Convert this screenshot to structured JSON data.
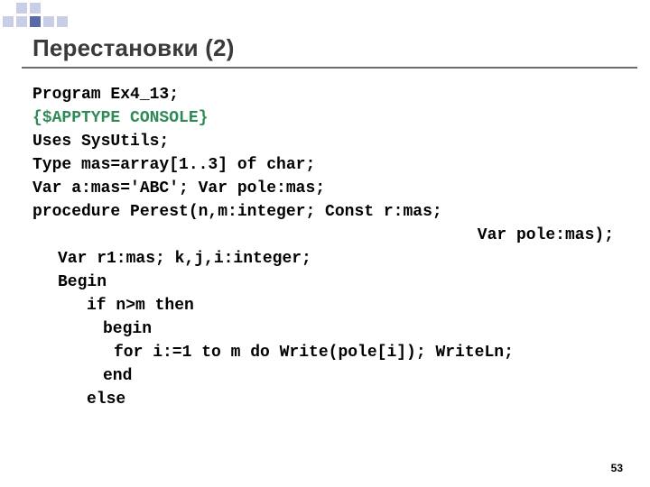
{
  "decor_pattern": [
    "n",
    "l",
    "l",
    "n",
    "n",
    "n",
    "l",
    "l",
    "d",
    "l",
    "l",
    "n"
  ],
  "title": "Перестановки (2)",
  "code": {
    "l1": "Program Ex4_13;",
    "l2": "{$APPTYPE CONSOLE}",
    "l3": "Uses SysUtils;",
    "l4": "Type mas=array[1..3] of char;",
    "l5": "Var a:mas='ABC'; Var pole:mas;",
    "l6": "procedure Perest(n,m:integer; Const r:mas;",
    "l7": "Var pole:mas);",
    "l8": "Var r1:mas; k,j,i:integer;",
    "l9": "Begin",
    "l10": "if n>m then",
    "l11": "begin",
    "l12": "for i:=1 to m do Write(pole[i]); WriteLn;",
    "l13": "end",
    "l14": "else"
  },
  "page_number": "53"
}
